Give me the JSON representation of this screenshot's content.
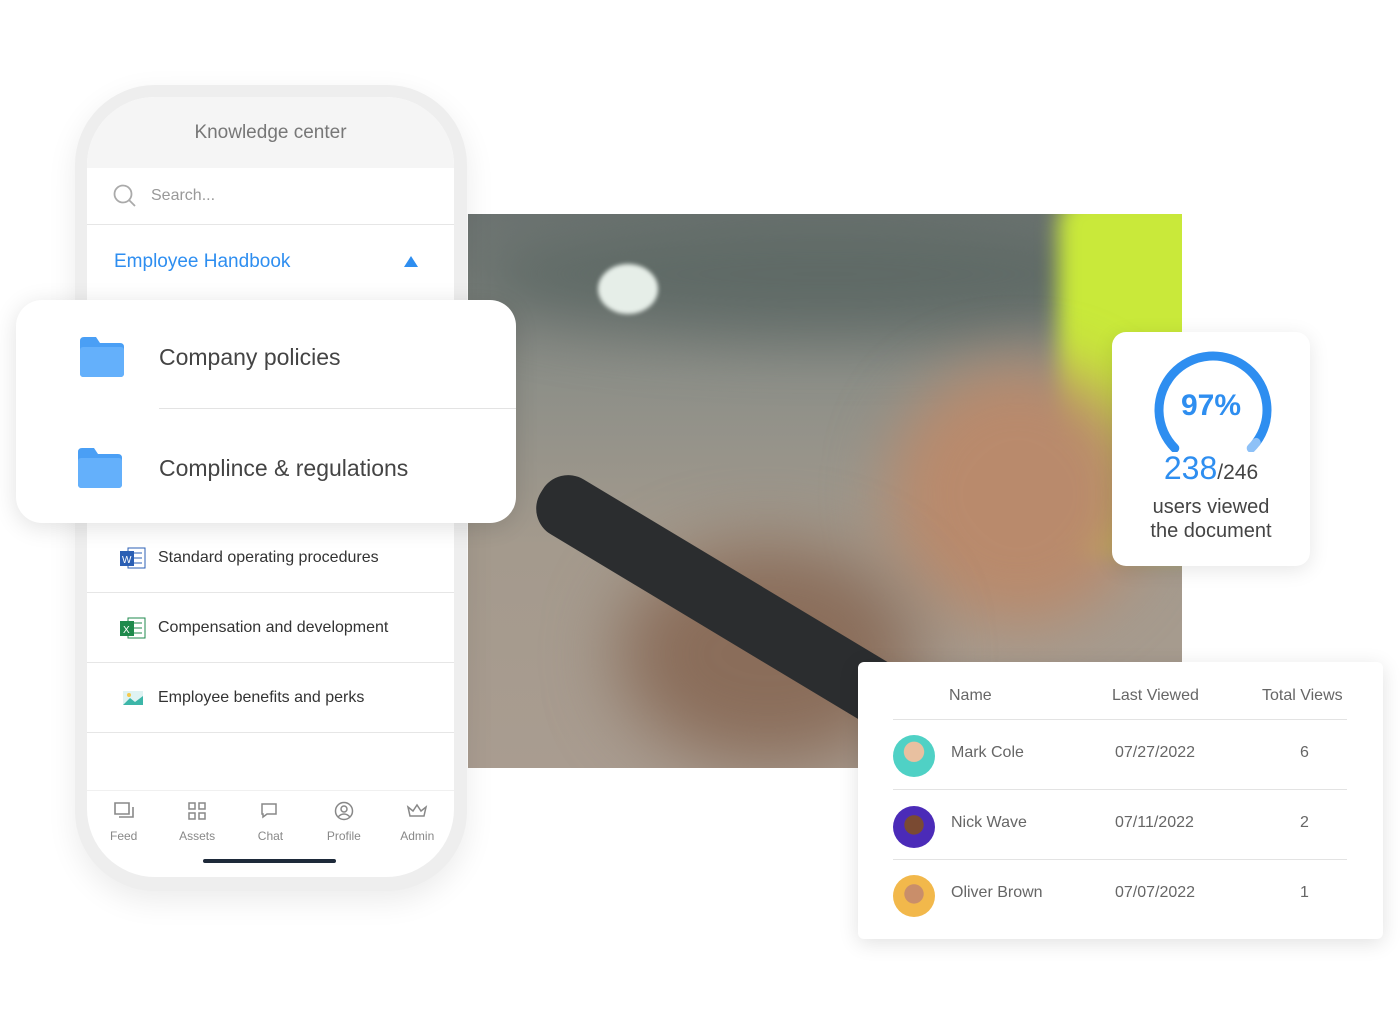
{
  "phone": {
    "title": "Knowledge center",
    "search_placeholder": "Search...",
    "section": "Employee Handbook",
    "folders": [
      {
        "label": "Company policies",
        "icon": "folder-icon"
      },
      {
        "label": "Complince & regulations",
        "icon": "folder-icon"
      }
    ],
    "files": [
      {
        "label": "Standard operating procedures",
        "icon": "word-doc-icon"
      },
      {
        "label": "Compensation and development",
        "icon": "excel-doc-icon"
      },
      {
        "label": "Employee benefits and perks",
        "icon": "image-file-icon"
      }
    ],
    "nav": [
      {
        "label": "Feed",
        "icon": "feed-icon"
      },
      {
        "label": "Assets",
        "icon": "grid-icon"
      },
      {
        "label": "Chat",
        "icon": "chat-icon"
      },
      {
        "label": "Profile",
        "icon": "profile-icon"
      },
      {
        "label": "Admin",
        "icon": "crown-icon"
      }
    ]
  },
  "gauge": {
    "percent_label": "97%",
    "percent": 97,
    "viewed": "238",
    "total": "/246",
    "caption_1": "users viewed",
    "caption_2": "the document",
    "color": "#2e8ef0"
  },
  "table": {
    "headers": {
      "name": "Name",
      "last": "Last Viewed",
      "total": "Total Views"
    },
    "rows": [
      {
        "name": "Mark Cole",
        "last": "07/27/2022",
        "views": "6"
      },
      {
        "name": "Nick Wave",
        "last": "07/11/2022",
        "views": "2"
      },
      {
        "name": "Oliver Brown",
        "last": "07/07/2022",
        "views": "1"
      }
    ]
  }
}
